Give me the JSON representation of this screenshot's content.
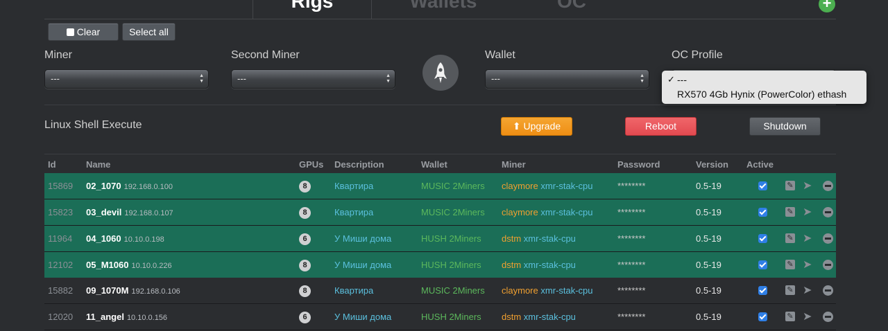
{
  "tabs": [
    {
      "label": "Rigs",
      "active": true
    },
    {
      "label": "Wallets",
      "active": false
    },
    {
      "label": "OC",
      "active": false
    }
  ],
  "add_label": "+",
  "toolbar": {
    "clear_label": "Clear",
    "select_all_label": "Select all"
  },
  "filters": {
    "miner": {
      "label": "Miner",
      "value": "---"
    },
    "second_miner": {
      "label": "Second Miner",
      "value": "---"
    },
    "wallet": {
      "label": "Wallet",
      "value": "---"
    },
    "oc_profile": {
      "label": "OC Profile",
      "options": [
        "---",
        "RX570 4Gb Hynix (PowerColor) ethash"
      ],
      "selected_check": "✓"
    }
  },
  "actions": {
    "shell_label": "Linux Shell Execute",
    "upgrade_label": "Upgrade",
    "reboot_label": "Reboot",
    "shutdown_label": "Shutdown"
  },
  "table": {
    "headers": [
      "Id",
      "Name",
      "GPUs",
      "Description",
      "Wallet",
      "Miner",
      "Password",
      "Version",
      "Active"
    ],
    "rows": [
      {
        "id": "15869",
        "name": "02_1070",
        "ip": "192.168.0.100",
        "gpus": "8",
        "desc": "Квартира",
        "wallet": "MUSIC 2Miners",
        "miner1": "claymore",
        "miner2": "xmr-stak-cpu",
        "pass": "********",
        "ver": "0.5-19"
      },
      {
        "id": "15823",
        "name": "03_devil",
        "ip": "192.168.0.107",
        "gpus": "8",
        "desc": "Квартира",
        "wallet": "MUSIC 2Miners",
        "miner1": "claymore",
        "miner2": "xmr-stak-cpu",
        "pass": "********",
        "ver": "0.5-19"
      },
      {
        "id": "11964",
        "name": "04_1060",
        "ip": "10.10.0.198",
        "gpus": "6",
        "desc": "У Миши дома",
        "wallet": "HUSH 2Miners",
        "miner1": "dstm",
        "miner2": "xmr-stak-cpu",
        "pass": "********",
        "ver": "0.5-19"
      },
      {
        "id": "12102",
        "name": "05_M1060",
        "ip": "10.10.0.226",
        "gpus": "8",
        "desc": "У Миши дома",
        "wallet": "HUSH 2Miners",
        "miner1": "dstm",
        "miner2": "xmr-stak-cpu",
        "pass": "********",
        "ver": "0.5-19"
      },
      {
        "id": "15882",
        "name": "09_1070M",
        "ip": "192.168.0.106",
        "gpus": "8",
        "desc": "Квартира",
        "wallet": "MUSIC 2Miners",
        "miner1": "claymore",
        "miner2": "xmr-stak-cpu",
        "pass": "********",
        "ver": "0.5-19"
      },
      {
        "id": "12020",
        "name": "11_angel",
        "ip": "10.10.0.156",
        "gpus": "6",
        "desc": "У Миши дома",
        "wallet": "HUSH 2Miners",
        "miner1": "dstm",
        "miner2": "xmr-stak-cpu",
        "pass": "********",
        "ver": "0.5-19"
      }
    ]
  },
  "colors": {
    "row_green": "#1b6e57",
    "accent_orange": "#ee8e14",
    "accent_red": "#e24a50",
    "link_blue": "#5bc0de",
    "wallet_green": "#5cb85c"
  }
}
